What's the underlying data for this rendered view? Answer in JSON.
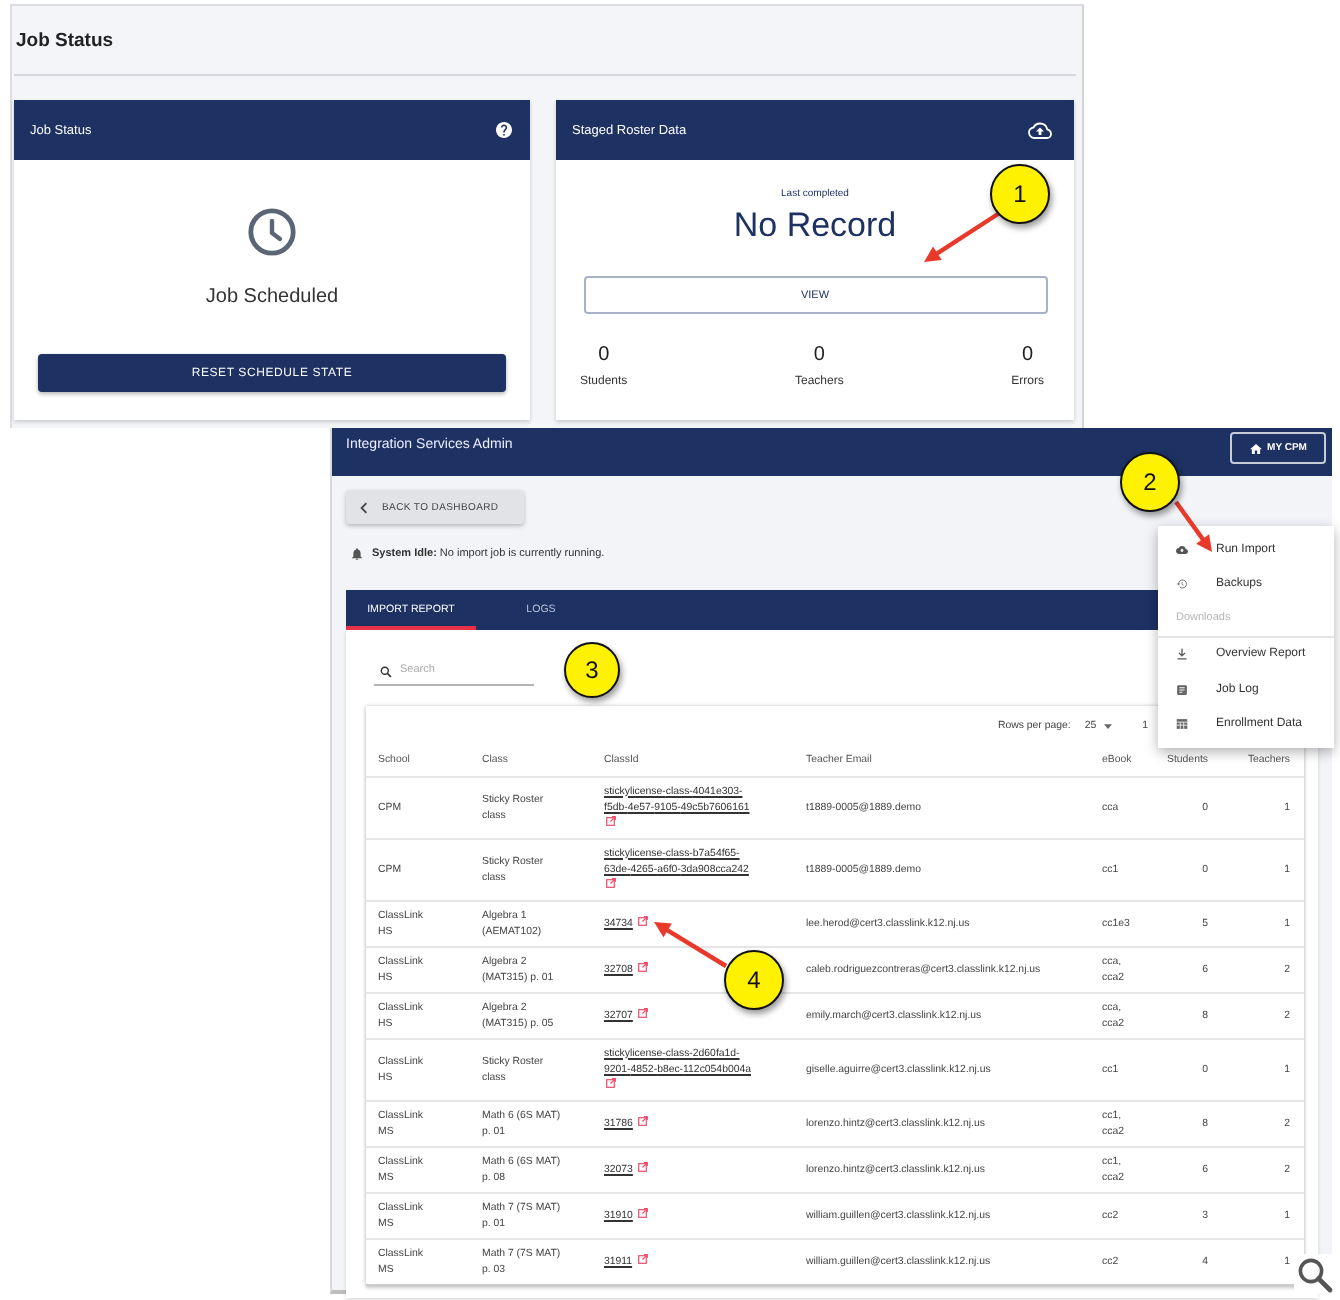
{
  "job_status_screen": {
    "title": "Job Status",
    "job_card": {
      "title": "Job Status",
      "status": "Job Scheduled",
      "button": "RESET SCHEDULE STATE"
    },
    "roster_card": {
      "title": "Staged Roster Data",
      "caption": "Last completed",
      "value": "No Record",
      "button": "VIEW",
      "stats": [
        {
          "value": "0",
          "label": "Students"
        },
        {
          "value": "0",
          "label": "Teachers"
        },
        {
          "value": "0",
          "label": "Errors"
        }
      ]
    }
  },
  "admin_screen": {
    "title": "Integration Services Admin",
    "home_button": "MY CPM",
    "back_button": "BACK TO DASHBOARD",
    "status_message": "**System Idle:** No import job is currently running.",
    "tabs": [
      {
        "label": "IMPORT REPORT",
        "selected": true
      },
      {
        "label": "LOGS",
        "selected": false
      }
    ],
    "search": {
      "placeholder": "Search"
    },
    "pagination": {
      "rows_per_page_label": "Rows per page:",
      "rows_per_page": "25",
      "range": "1"
    },
    "table": {
      "columns": [
        "School",
        "Class",
        "ClassId",
        "Teacher Email",
        "eBook",
        "Students",
        "Teachers"
      ],
      "rows": [
        {
          "school": "CPM",
          "class": "Sticky Roster class",
          "class_id": "stickylicense-class-4041e303-f5db-4e57-9105-49c5b7606161",
          "teacher_email": "t1889-0005@1889.demo",
          "ebook": "cca",
          "students": "0",
          "teachers": "1"
        },
        {
          "school": "CPM",
          "class": "Sticky Roster class",
          "class_id": "stickylicense-class-b7a54f65-63de-4265-a6f0-3da908cca242",
          "teacher_email": "t1889-0005@1889.demo",
          "ebook": "cc1",
          "students": "0",
          "teachers": "1"
        },
        {
          "school": "ClassLink HS",
          "class": "Algebra 1 (AEMAT102)",
          "class_id": "34734",
          "teacher_email": "lee.herod@cert3.classlink.k12.nj.us",
          "ebook": "cc1e3",
          "students": "5",
          "teachers": "1"
        },
        {
          "school": "ClassLink HS",
          "class": "Algebra 2 (MAT315) p. 01",
          "class_id": "32708",
          "teacher_email": "caleb.rodriguezcontreras@cert3.classlink.k12.nj.us",
          "ebook": "cca, cca2",
          "students": "6",
          "teachers": "2"
        },
        {
          "school": "ClassLink HS",
          "class": "Algebra 2 (MAT315) p. 05",
          "class_id": "32707",
          "teacher_email": "emily.march@cert3.classlink.k12.nj.us",
          "ebook": "cca, cca2",
          "students": "8",
          "teachers": "2"
        },
        {
          "school": "ClassLink HS",
          "class": "Sticky Roster class",
          "class_id": "stickylicense-class-2d60fa1d-9201-4852-b8ec-112c054b004a",
          "teacher_email": "giselle.aguirre@cert3.classlink.k12.nj.us",
          "ebook": "cc1",
          "students": "0",
          "teachers": "1"
        },
        {
          "school": "ClassLink MS",
          "class": "Math 6 (6S MAT) p. 01",
          "class_id": "31786",
          "teacher_email": "lorenzo.hintz@cert3.classlink.k12.nj.us",
          "ebook": "cc1, cca2",
          "students": "8",
          "teachers": "2"
        },
        {
          "school": "ClassLink MS",
          "class": "Math 6 (6S MAT) p. 08",
          "class_id": "32073",
          "teacher_email": "lorenzo.hintz@cert3.classlink.k12.nj.us",
          "ebook": "cc1, cca2",
          "students": "6",
          "teachers": "2"
        },
        {
          "school": "ClassLink MS",
          "class": "Math 7 (7S MAT) p. 01",
          "class_id": "31910",
          "teacher_email": "william.guillen@cert3.classlink.k12.nj.us",
          "ebook": "cc2",
          "students": "3",
          "teachers": "1"
        },
        {
          "school": "ClassLink MS",
          "class": "Math 7 (7S MAT) p. 03",
          "class_id": "31911",
          "teacher_email": "william.guillen@cert3.classlink.k12.nj.us",
          "ebook": "cc2",
          "students": "4",
          "teachers": "1"
        }
      ]
    },
    "menu": {
      "items": [
        {
          "kind": "item",
          "label": "Run Import"
        },
        {
          "kind": "item",
          "label": "Backups"
        },
        {
          "kind": "header",
          "label": "Downloads"
        },
        {
          "kind": "item",
          "label": "Overview Report"
        },
        {
          "kind": "item",
          "label": "Job Log"
        },
        {
          "kind": "item",
          "label": "Enrollment Data"
        }
      ]
    }
  },
  "callouts": [
    {
      "number": "1",
      "arrow": true
    },
    {
      "number": "2",
      "arrow": true
    },
    {
      "number": "3",
      "arrow": false
    },
    {
      "number": "4",
      "arrow": true
    }
  ]
}
